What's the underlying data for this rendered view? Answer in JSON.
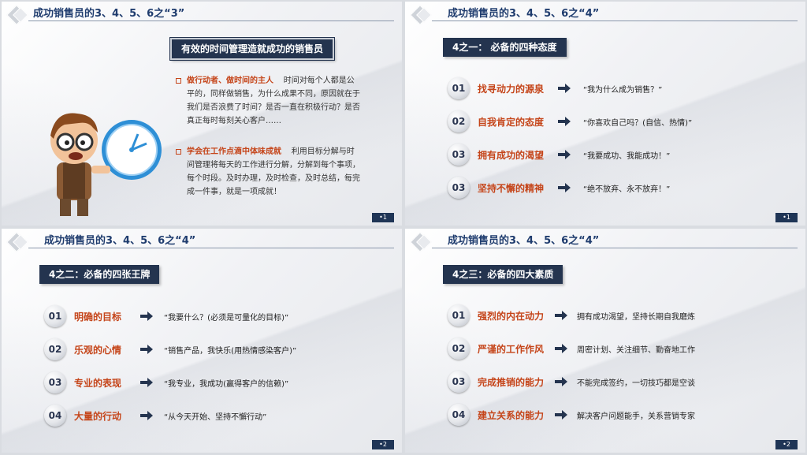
{
  "slides": [
    {
      "title": "成功销售员的3、4、5、6之“3”",
      "header": "有效的时间管理造就成功的销售员",
      "points": [
        {
          "key": "做行动者、做时间的主人",
          "text": "时间对每个人都是公平的，同样做销售，为什么成果不同，原因就在于我们是否浪费了时间？是否一直在积极行动？是否真正每时每刻关心客户……"
        },
        {
          "key": "学会在工作点滴中体味成就",
          "text": "利用目标分解与时间管理将每天的工作进行分解，分解到每个事项，每个时段。及时办理，及时检查，及时总结，每完成一件事，就是一项成就！"
        }
      ],
      "page": "•1"
    },
    {
      "title": "成功销售员的3、4、5、6之“4”",
      "header": "4之一：  必备的四种态度",
      "rows": [
        {
          "num": "01",
          "key": "找寻动力的源泉",
          "desc": "“我为什么成为销售？”"
        },
        {
          "num": "02",
          "key": "自我肯定的态度",
          "desc": "“你喜欢自己吗？(自信、热情)”"
        },
        {
          "num": "03",
          "key": "拥有成功的渴望",
          "desc": "“我要成功、我能成功！”"
        },
        {
          "num": "03",
          "key": "坚持不懈的精神",
          "desc": "“绝不放弃、永不放弃！”"
        }
      ],
      "page": "•1"
    },
    {
      "title": "成功销售员的3、4、5、6之“4”",
      "header": "4之二：必备的四张王牌",
      "rows": [
        {
          "num": "01",
          "key": "明确的目标",
          "desc": "“我要什么？(必须是可量化的目标)”"
        },
        {
          "num": "02",
          "key": "乐观的心情",
          "desc": "“销售产品，我快乐(用热情感染客户)”"
        },
        {
          "num": "03",
          "key": "专业的表现",
          "desc": "“我专业，我成功(赢得客户的信赖)”"
        },
        {
          "num": "04",
          "key": "大量的行动",
          "desc": "“从今天开始、坚持不懈行动”"
        }
      ],
      "page": "•2"
    },
    {
      "title": "成功销售员的3、4、5、6之“4”",
      "header": "4之三：必备的四大素质",
      "rows": [
        {
          "num": "01",
          "key": "强烈的内在动力",
          "desc": "拥有成功渴望，坚持长期自我磨炼"
        },
        {
          "num": "02",
          "key": "严谨的工作作风",
          "desc": "周密计划、关注细节、勤奋地工作"
        },
        {
          "num": "03",
          "key": "完成推销的能力",
          "desc": "不能完成签约，一切技巧都是空谈"
        },
        {
          "num": "04",
          "key": "建立关系的能力",
          "desc": "解决客户问题能手，关系营销专家"
        }
      ],
      "page": "•2"
    }
  ],
  "colors": {
    "title": "#1f3c6e",
    "accent": "#c5451a",
    "header_bg": "#24344f"
  }
}
